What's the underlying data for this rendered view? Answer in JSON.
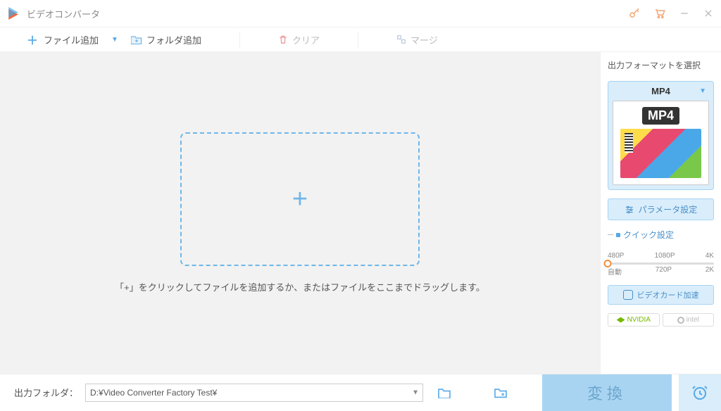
{
  "titlebar": {
    "title": "ビデオコンバータ"
  },
  "toolbar": {
    "add_file": "ファイル追加",
    "add_folder": "フォルダ追加",
    "clear": "クリア",
    "merge": "マージ"
  },
  "drop": {
    "plus": "+",
    "hint": "「+」をクリックしてファイルを追加するか、またはファイルをここまでドラッグします。"
  },
  "sidebar": {
    "format_title": "出力フォーマットを選択",
    "selected_format": "MP4",
    "thumb_label": "MP4",
    "param_btn": "パラメータ設定",
    "quick_title": "クイック設定",
    "slider_top": [
      "480P",
      "1080P",
      "4K"
    ],
    "slider_bottom": [
      "自動",
      "720P",
      "2K"
    ],
    "gpu_btn": "ビデオカード加速",
    "vendor_nvidia": "NVIDIA",
    "vendor_intel": "intel"
  },
  "bottom": {
    "label": "出力フォルダ：",
    "path": "D:¥Video Converter Factory Test¥",
    "convert": "変換"
  }
}
